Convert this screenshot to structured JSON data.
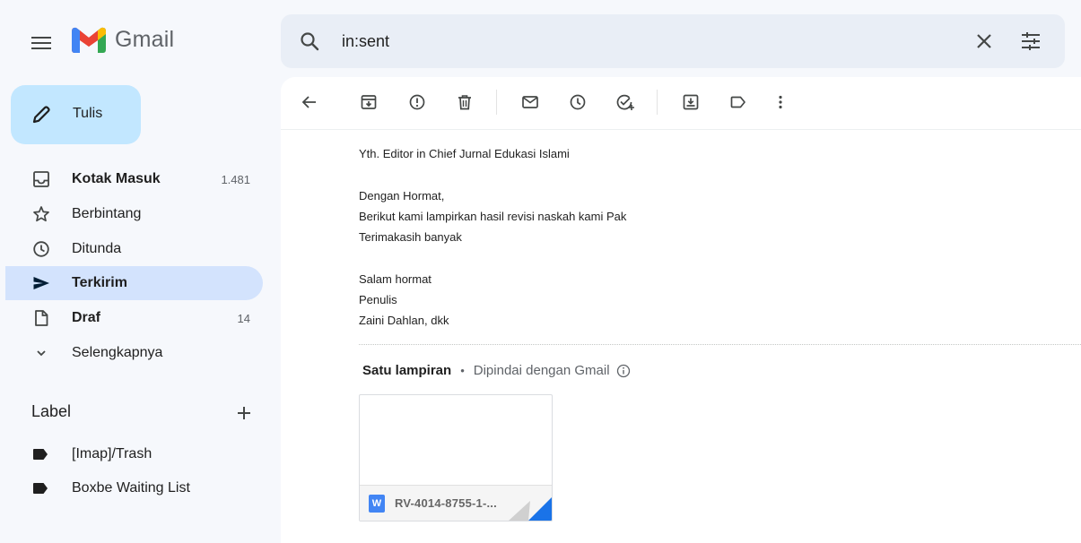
{
  "app": {
    "name": "Gmail"
  },
  "search": {
    "query": "in:sent"
  },
  "compose": {
    "label": "Tulis"
  },
  "nav": [
    {
      "label": "Kotak Masuk",
      "count": "1.481",
      "bold": true,
      "icon": "inbox-icon"
    },
    {
      "label": "Berbintang",
      "count": "",
      "bold": false,
      "icon": "star-icon"
    },
    {
      "label": "Ditunda",
      "count": "",
      "bold": false,
      "icon": "clock-icon"
    },
    {
      "label": "Terkirim",
      "count": "",
      "bold": true,
      "active": true,
      "icon": "send-icon"
    },
    {
      "label": "Draf",
      "count": "14",
      "bold": true,
      "icon": "draft-icon"
    },
    {
      "label": "Selengkapnya",
      "count": "",
      "bold": false,
      "icon": "chevron-down-icon"
    }
  ],
  "labels_section": {
    "title": "Label",
    "items": [
      {
        "label": "[Imap]/Trash",
        "icon": "label-icon"
      },
      {
        "label": "Boxbe Waiting List",
        "icon": "label-icon"
      }
    ]
  },
  "toolbar": {
    "icons": [
      "back-arrow-icon",
      "archive-icon",
      "report-spam-icon",
      "delete-icon",
      "mark-unread-icon",
      "snooze-icon",
      "add-task-icon",
      "move-to-icon",
      "label-as-icon",
      "more-vert-icon"
    ]
  },
  "email": {
    "body": [
      "Yth. Editor in Chief Jurnal Edukasi Islami",
      "",
      "Dengan Hormat,",
      "Berikut kami lampirkan hasil revisi naskah kami Pak",
      "Terimakasih banyak",
      "",
      "Salam hormat",
      "Penulis",
      "Zaini Dahlan, dkk"
    ]
  },
  "attachments": {
    "title": "Satu lampiran",
    "separator": "•",
    "scan_note": "Dipindai dengan Gmail",
    "file": {
      "type_letter": "W",
      "name": "RV-4014-8755-1-..."
    }
  },
  "colors": {
    "background": "#f6f8fc",
    "search_bg": "#e9eef6",
    "compose_bg": "#c2e7ff",
    "active_nav": "#d3e3fd",
    "word_blue": "#4285f4"
  }
}
